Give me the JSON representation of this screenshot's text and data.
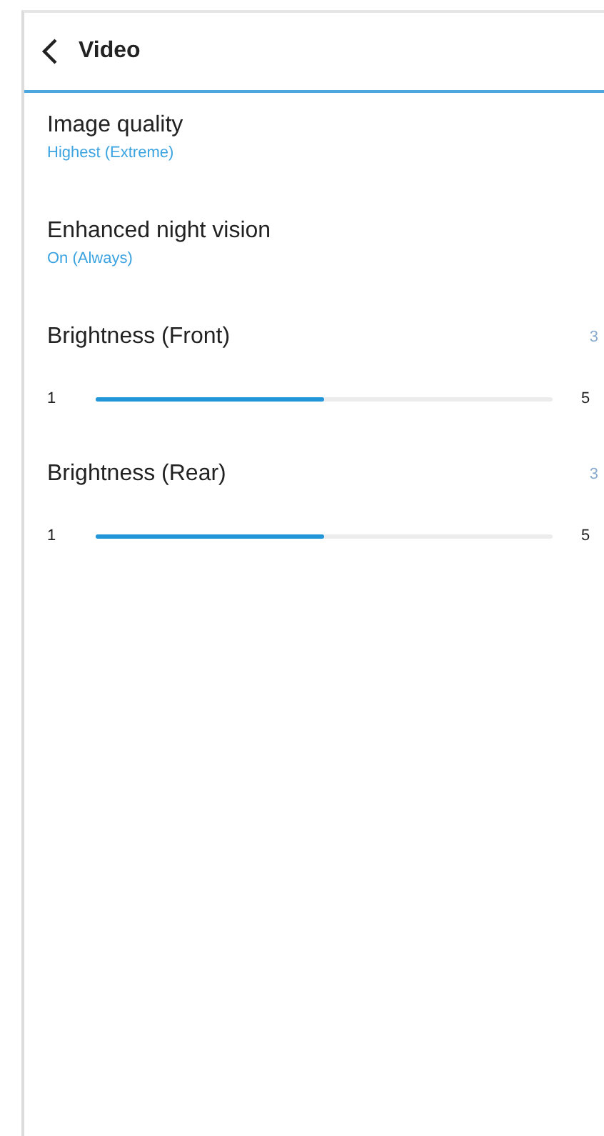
{
  "header": {
    "title": "Video"
  },
  "settings": [
    {
      "kind": "choice",
      "label": "Image quality",
      "value": "Highest (Extreme)"
    },
    {
      "kind": "choice",
      "label": "Enhanced night vision",
      "value": "On (Always)"
    },
    {
      "kind": "slider",
      "label": "Brightness (Front)",
      "reading": "3",
      "min": "1",
      "max": "5",
      "level": 0.5
    },
    {
      "kind": "slider",
      "label": "Brightness (Rear)",
      "reading": "3",
      "min": "1",
      "max": "5",
      "level": 0.5
    }
  ]
}
